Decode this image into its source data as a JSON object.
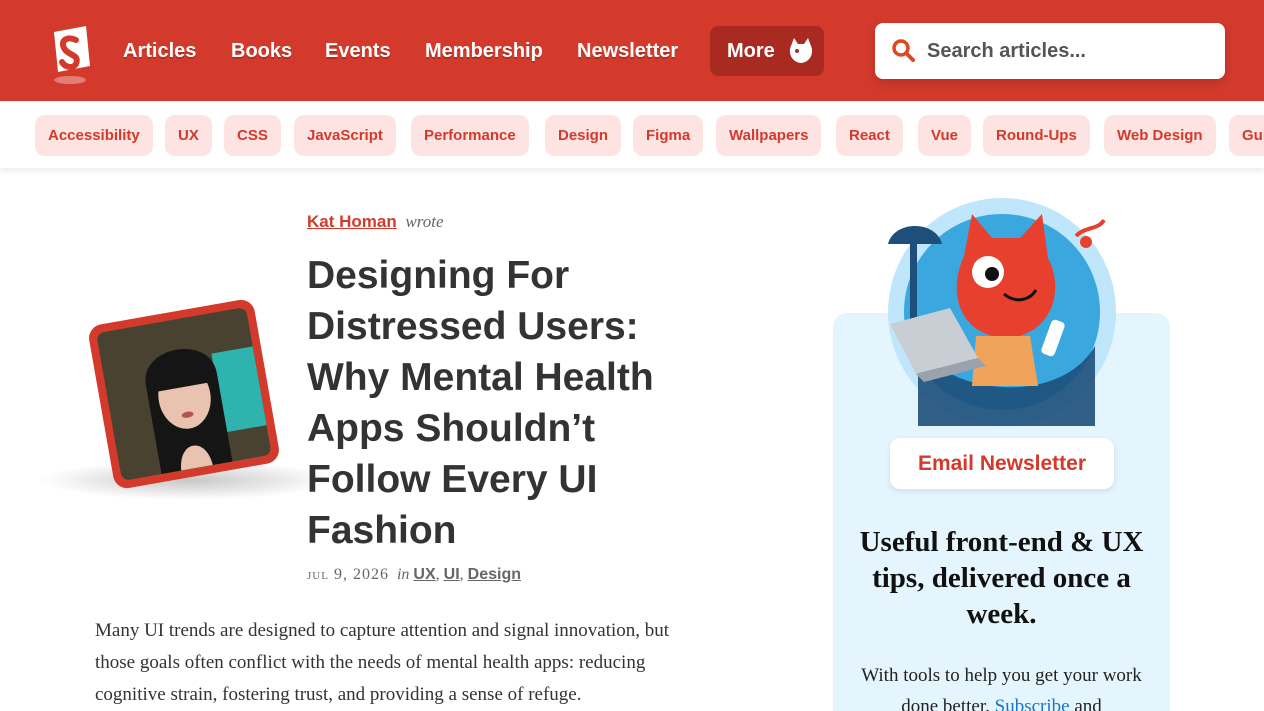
{
  "nav": {
    "items": [
      "Articles",
      "Books",
      "Events",
      "Membership",
      "Newsletter"
    ],
    "more_label": "More"
  },
  "search": {
    "placeholder": "Search articles..."
  },
  "tags": [
    "Accessibility",
    "UX",
    "CSS",
    "JavaScript",
    "Performance",
    "Design",
    "Figma",
    "Wallpapers",
    "React",
    "Vue",
    "Round-Ups",
    "Web Design",
    "Guides"
  ],
  "article": {
    "author": "Kat Homan",
    "wrote": "wrote",
    "title": "Designing For Distressed Users: Why Mental Health Apps Shouldn’t Follow Every UI Fashion",
    "date": "jul 9, 2026",
    "in_word": "in",
    "categories": [
      "UX",
      "UI",
      "Design"
    ],
    "intro": "Many UI trends are designed to capture attention and signal innovation, but those goals often conflict with the needs of mental health apps: reducing cognitive strain, fostering trust, and providing a sense of refuge."
  },
  "sidebar": {
    "button": "Email Newsletter",
    "heading": "Useful front-end & UX tips, delivered once a week.",
    "text_before": "With tools to help you get your work done better.",
    "subscribe_link": "Subscribe",
    "text_after": "and"
  },
  "colors": {
    "brand": "#d33a2c",
    "tag_bg": "#fde3e1",
    "sidebar_bg": "#e4f5fe"
  }
}
